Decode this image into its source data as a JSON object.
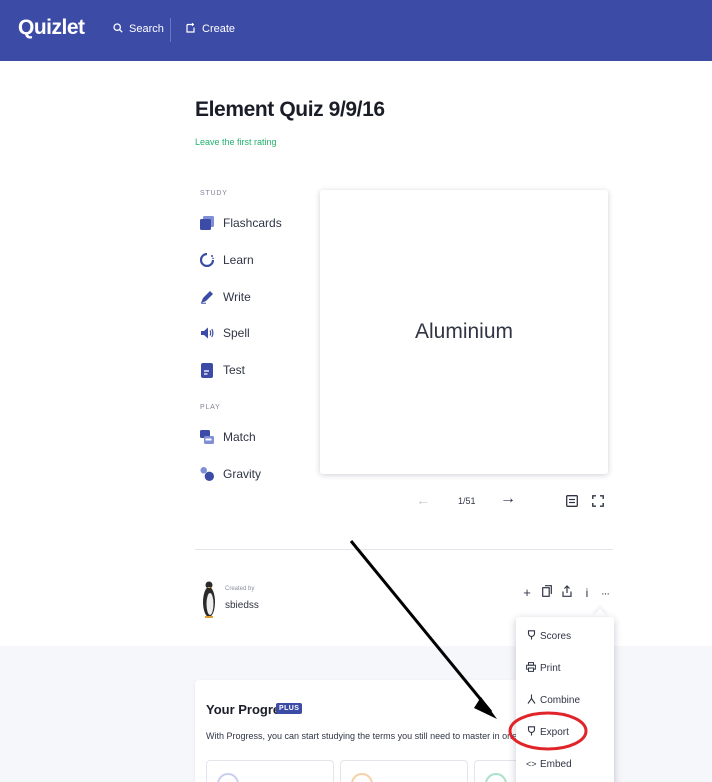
{
  "header": {
    "logo": "Quizlet",
    "search_label": "Search",
    "create_label": "Create",
    "background": "#3c4ca6"
  },
  "set": {
    "title": "Element Quiz 9/9/16",
    "rating_link": "Leave the first rating"
  },
  "study": {
    "label": "STUDY",
    "modes": [
      {
        "label": "Flashcards",
        "icon": "flashcards-icon"
      },
      {
        "label": "Learn",
        "icon": "learn-icon"
      },
      {
        "label": "Write",
        "icon": "write-icon"
      },
      {
        "label": "Spell",
        "icon": "spell-icon"
      },
      {
        "label": "Test",
        "icon": "test-icon"
      }
    ]
  },
  "play": {
    "label": "PLAY",
    "modes": [
      {
        "label": "Match",
        "icon": "match-icon"
      },
      {
        "label": "Gravity",
        "icon": "gravity-icon"
      }
    ]
  },
  "flashcard": {
    "term": "Aluminium",
    "counter": "1/51"
  },
  "creator": {
    "created_by_label": "Created by",
    "name": "sbiedss"
  },
  "actions": [
    "add-icon",
    "copy-icon",
    "share-icon",
    "info-icon",
    "more-icon"
  ],
  "menu": {
    "items": [
      {
        "label": "Scores",
        "icon": "trophy-icon"
      },
      {
        "label": "Print",
        "icon": "print-icon"
      },
      {
        "label": "Combine",
        "icon": "combine-icon"
      },
      {
        "label": "Export",
        "icon": "export-icon"
      },
      {
        "label": "Embed",
        "icon": "embed-icon"
      }
    ],
    "highlighted": "Export"
  },
  "progress": {
    "title": "Your Progress",
    "badge": "PLUS",
    "description": "With Progress, you can start studying the terms you still need to master in one click."
  },
  "colors": {
    "accent": "#3c4ca6",
    "link_green": "#23b26d",
    "highlight_red": "#e0242a"
  }
}
